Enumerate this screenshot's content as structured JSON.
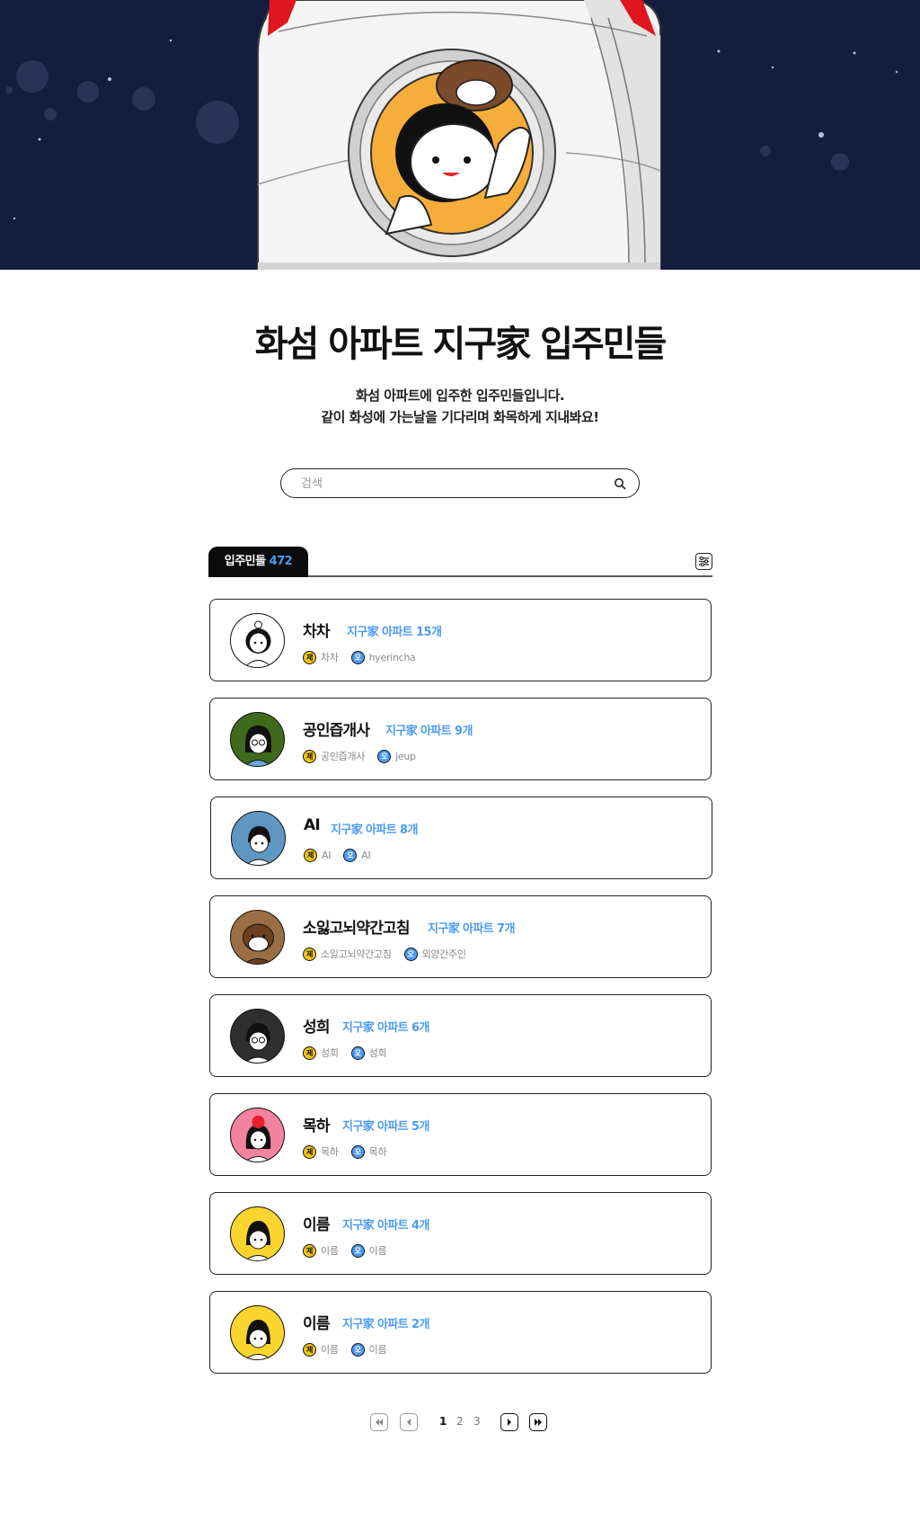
{
  "header": {
    "title": "화섬 아파트 지구家 입주민들",
    "desc_line1": "화섬 아파트에 입주한 입주민들입니다.",
    "desc_line2": "같이 화성에 가는날을 기다리며 화목하게 지내봐요!"
  },
  "search": {
    "placeholder": "검색",
    "icon": "search-icon"
  },
  "tabs": {
    "label": "입주민들",
    "count": "472",
    "filter_icon": "sliders-icon"
  },
  "badges": {
    "je": "제",
    "o": "오"
  },
  "residents": [
    {
      "name": "차차",
      "apartments": "지구家 아파트 15개",
      "je": "차차",
      "o": "hyerincha",
      "avatar_bg": "#ffffff"
    },
    {
      "name": "공인즙개사",
      "apartments": "지구家 아파트 9개",
      "je": "공인즙개사",
      "o": "jeup",
      "avatar_bg": "#3f6a1c"
    },
    {
      "name": "AI",
      "apartments": "지구家 아파트 8개",
      "je": "AI",
      "o": "AI",
      "avatar_bg": "#5f97c4"
    },
    {
      "name": "소잃고뇌약간고침",
      "apartments": "지구家 아파트 7개",
      "je": "소잃고뇌약간고침",
      "o": "외양간주인",
      "avatar_bg": "#9a6e45"
    },
    {
      "name": "성희",
      "apartments": "지구家 아파트 6개",
      "je": "성희",
      "o": "성희",
      "avatar_bg": "#2f2f2f"
    },
    {
      "name": "목하",
      "apartments": "지구家 아파트 5개",
      "je": "목하",
      "o": "목하",
      "avatar_bg": "#f2829d"
    },
    {
      "name": "이름",
      "apartments": "지구家 아파트 4개",
      "je": "이름",
      "o": "이름",
      "avatar_bg": "#fbd42e"
    },
    {
      "name": "이름",
      "apartments": "지구家 아파트 2개",
      "je": "이름",
      "o": "이름",
      "avatar_bg": "#fbd42e"
    }
  ],
  "pagination": {
    "pages": [
      "1",
      "2",
      "3"
    ],
    "current": "1"
  },
  "colors": {
    "accent": "#4b9bf2",
    "hero_bg": "#141d3d",
    "badge_je": "#f5c518",
    "badge_o": "#4b9bf2"
  }
}
